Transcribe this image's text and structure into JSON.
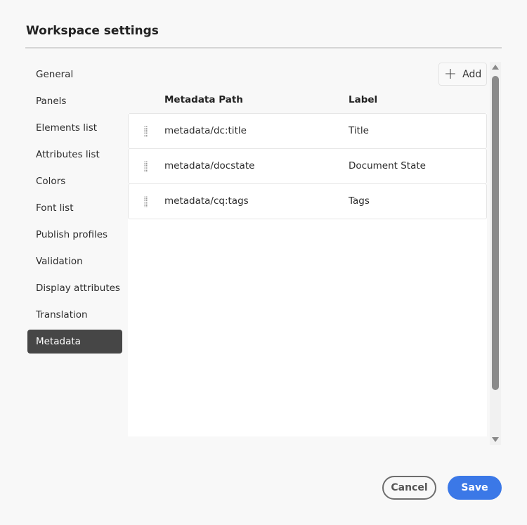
{
  "title": "Workspace settings",
  "nav": [
    "General",
    "Panels",
    "Elements list",
    "Attributes list",
    "Colors",
    "Font list",
    "Publish profiles",
    "Validation",
    "Display attributes",
    "Translation",
    "Metadata"
  ],
  "active_nav": "Metadata",
  "add_label": "Add",
  "columns": {
    "path": "Metadata Path",
    "label": "Label"
  },
  "rows": [
    {
      "path": "metadata/dc:title",
      "label": "Title"
    },
    {
      "path": "metadata/docstate",
      "label": "Document State"
    },
    {
      "path": "metadata/cq:tags",
      "label": "Tags"
    }
  ],
  "cancel_label": "Cancel",
  "save_label": "Save"
}
